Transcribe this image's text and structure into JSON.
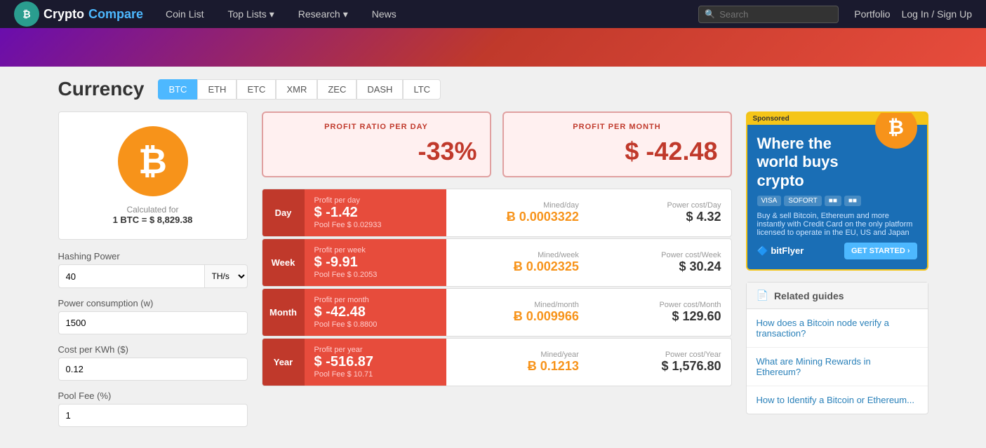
{
  "navbar": {
    "brand": {
      "name_crypto": "Crypto",
      "name_compare": "Compare"
    },
    "links": [
      {
        "label": "Coin List",
        "id": "coin-list"
      },
      {
        "label": "Top Lists",
        "id": "top-lists",
        "has_arrow": true
      },
      {
        "label": "Research",
        "id": "research",
        "has_arrow": true
      },
      {
        "label": "News",
        "id": "news"
      }
    ],
    "search_placeholder": "Search",
    "portfolio_label": "Portfolio",
    "auth_label": "Log In / Sign Up"
  },
  "currency": {
    "title": "Currency",
    "tabs": [
      {
        "id": "btc",
        "label": "BTC",
        "active": true
      },
      {
        "id": "eth",
        "label": "ETH"
      },
      {
        "id": "etc",
        "label": "ETC"
      },
      {
        "id": "xmr",
        "label": "XMR"
      },
      {
        "id": "zec",
        "label": "ZEC"
      },
      {
        "id": "dash",
        "label": "DASH"
      },
      {
        "id": "ltc",
        "label": "LTC"
      }
    ]
  },
  "coin": {
    "symbol": "₿",
    "calc_label": "Calculated for",
    "calc_value": "1 BTC = $ 8,829.38"
  },
  "form": {
    "hashing_power_label": "Hashing Power",
    "hashing_power_value": "40",
    "hashing_unit": "TH/s",
    "power_consumption_label": "Power consumption (w)",
    "power_consumption_value": "1500",
    "cost_per_kwh_label": "Cost per KWh ($)",
    "cost_per_kwh_value": "0.12",
    "pool_fee_label": "Pool Fee (%)",
    "pool_fee_value": "1"
  },
  "profit_summary": {
    "ratio_label": "PROFIT RATIO PER DAY",
    "ratio_value": "-33%",
    "month_label": "PROFIT PER MONTH",
    "month_value": "$ -42.48"
  },
  "rows": [
    {
      "period": "Day",
      "profit_label": "Profit per day",
      "profit_value": "$ -1.42",
      "pool_fee": "Pool Fee $ 0.02933",
      "mined_label": "Mined/day",
      "mined_value": "Ƀ 0.0003322",
      "power_label": "Power cost/Day",
      "power_value": "$ 4.32"
    },
    {
      "period": "Week",
      "profit_label": "Profit per week",
      "profit_value": "$ -9.91",
      "pool_fee": "Pool Fee $ 0.2053",
      "mined_label": "Mined/week",
      "mined_value": "Ƀ 0.002325",
      "power_label": "Power cost/Week",
      "power_value": "$ 30.24"
    },
    {
      "period": "Month",
      "profit_label": "Profit per month",
      "profit_value": "$ -42.48",
      "pool_fee": "Pool Fee $ 0.8800",
      "mined_label": "Mined/month",
      "mined_value": "Ƀ 0.009966",
      "power_label": "Power cost/Month",
      "power_value": "$ 129.60"
    },
    {
      "period": "Year",
      "profit_label": "Profit per year",
      "profit_value": "$ -516.87",
      "pool_fee": "Pool Fee $ 10.71",
      "mined_label": "Mined/year",
      "mined_value": "Ƀ 0.1213",
      "power_label": "Power cost/Year",
      "power_value": "$ 1,576.80"
    }
  ],
  "ad": {
    "sponsored": "Sponsored",
    "title": "Where the world buys crypto",
    "description": "Buy & sell Bitcoin, Ethereum and more instantly with Credit Card on the only platform licensed to operate in the EU, US and Japan",
    "logo": "bitFlyer",
    "cta": "GET STARTED ›"
  },
  "related_guides": {
    "header": "Related guides",
    "links": [
      "How does a Bitcoin node verify a transaction?",
      "What are Mining Rewards in Ethereum?",
      "How to Identify a Bitcoin or Ethereum..."
    ]
  }
}
